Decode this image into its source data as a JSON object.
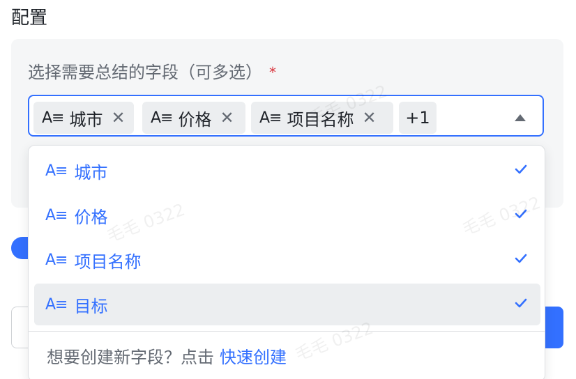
{
  "section": {
    "title": "配置"
  },
  "field": {
    "label": "选择需要总结的字段（可多选）",
    "required_mark": "*"
  },
  "select": {
    "field_icon_glyph": "A≡",
    "selected_tags": [
      "城市",
      "价格",
      "项目名称"
    ],
    "more_count": "+1",
    "close_glyph": "✕"
  },
  "dropdown": {
    "options": [
      {
        "label": "城市",
        "checked": true
      },
      {
        "label": "价格",
        "checked": true
      },
      {
        "label": "项目名称",
        "checked": true
      },
      {
        "label": "目标",
        "checked": true,
        "hovered": true
      }
    ],
    "footer_text": "想要创建新字段？点击",
    "footer_link": "快速创建"
  },
  "watermark": "毛毛 0322",
  "colors": {
    "accent": "#3370ff",
    "required": "#d9363e",
    "panel_bg": "#f5f6f7",
    "tag_bg": "#eceef0"
  },
  "icons": {
    "field_type": "text-field-icon",
    "remove": "close-icon",
    "dropdown_caret": "caret-up-icon",
    "selected": "checkmark-icon"
  }
}
